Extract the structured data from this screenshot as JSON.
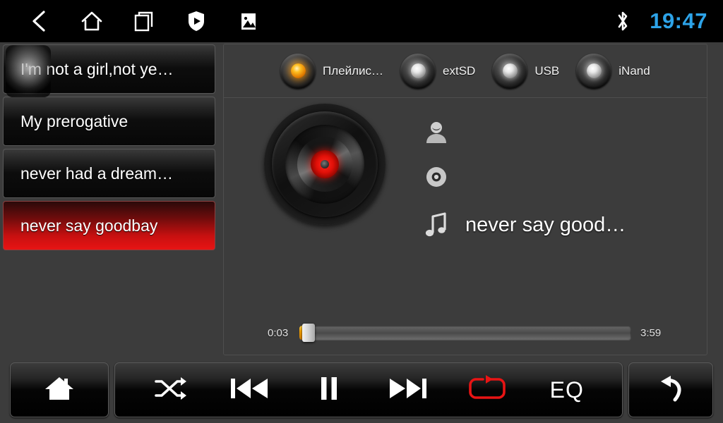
{
  "statusbar": {
    "icons": [
      {
        "name": "back-icon",
        "label": "Back"
      },
      {
        "name": "home-icon",
        "label": "Home"
      },
      {
        "name": "recent-apps-icon",
        "label": "Recent apps"
      },
      {
        "name": "shield-play-icon",
        "label": "Secure media"
      },
      {
        "name": "gallery-icon",
        "label": "Gallery"
      }
    ],
    "bluetooth_icon": "bluetooth-icon",
    "time": "19:47",
    "time_color": "#2da3e8"
  },
  "playlist": {
    "items": [
      {
        "title": "I'm not a girl,not ye…",
        "selected": false
      },
      {
        "title": "My prerogative",
        "selected": false
      },
      {
        "title": "never had a dream…",
        "selected": false
      },
      {
        "title": "never say goodbay",
        "selected": true
      }
    ],
    "selected_color": "#e81414"
  },
  "sources": {
    "tabs": [
      {
        "label": "Плейлис…",
        "active": true
      },
      {
        "label": "extSD",
        "active": false
      },
      {
        "label": "USB",
        "active": false
      },
      {
        "label": "iNand",
        "active": false
      }
    ],
    "active_led_color": "#ffbe20",
    "idle_led_color": "#e8e8e8"
  },
  "now_playing": {
    "artist": "",
    "album": "",
    "title": "never say good…",
    "artist_icon": "person-icon",
    "album_icon": "disc-icon",
    "title_icon": "music-note-icon",
    "disc_label_color": "#e01008"
  },
  "progress": {
    "current_time": "0:03",
    "total_time": "3:59",
    "percent": 1.3,
    "fill_color": "#f5a200"
  },
  "controls": {
    "home": {
      "label": "Home",
      "icon": "home-icon"
    },
    "shuffle": {
      "label": "Shuffle",
      "icon": "shuffle-icon",
      "active": false
    },
    "previous": {
      "label": "Previous",
      "icon": "previous-track-icon"
    },
    "playpause": {
      "label": "Pause",
      "icon": "pause-icon"
    },
    "next": {
      "label": "Next",
      "icon": "next-track-icon"
    },
    "repeat": {
      "label": "Repeat",
      "icon": "repeat-icon",
      "active": true,
      "color": "#e81414"
    },
    "eq": {
      "label": "EQ",
      "icon": "equalizer-label"
    },
    "back": {
      "label": "Back",
      "icon": "return-arrow-icon"
    }
  }
}
